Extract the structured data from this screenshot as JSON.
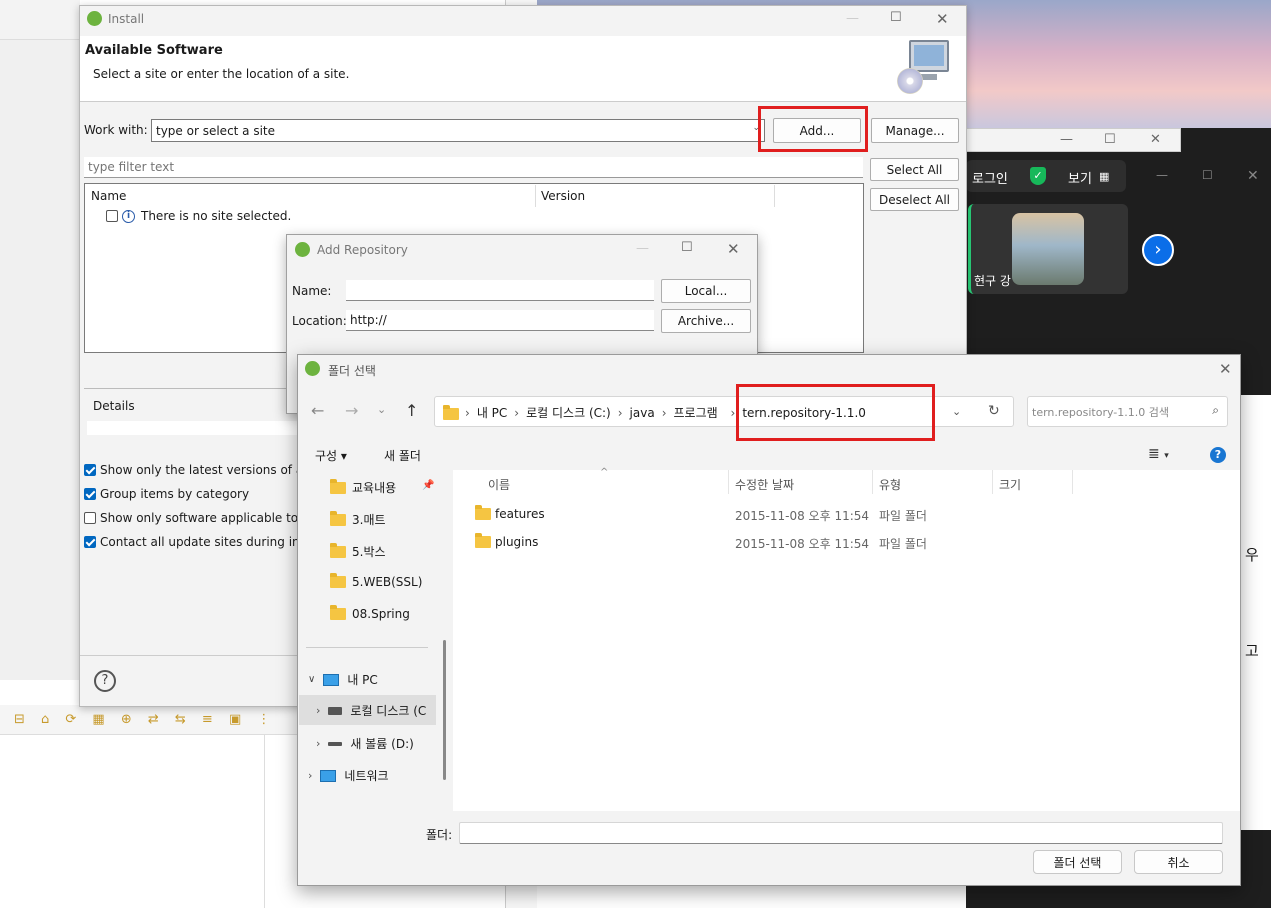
{
  "install": {
    "title": "Install",
    "heading": "Available Software",
    "subheading": "Select a site or enter the location of a site.",
    "work_with_label": "Work with:",
    "work_with_placeholder": "type or select a site",
    "add_button": "Add...",
    "manage_button": "Manage...",
    "filter_placeholder": "type filter text",
    "select_all": "Select All",
    "deselect_all": "Deselect All",
    "col_name": "Name",
    "col_version": "Version",
    "empty_row": "There is no site selected.",
    "details_label": "Details",
    "options": [
      {
        "label": "Show only the latest versions of avai",
        "checked": true
      },
      {
        "label": "Group items by category",
        "checked": true
      },
      {
        "label": "Show only software applicable to tar",
        "checked": false
      },
      {
        "label": "Contact all update sites during instal",
        "checked": true
      }
    ]
  },
  "add_repository": {
    "title": "Add Repository",
    "name_label": "Name:",
    "name_value": "",
    "location_label": "Location:",
    "location_value": "http://",
    "local_button": "Local...",
    "archive_button": "Archive..."
  },
  "folder_dialog": {
    "title": "폴더 선택",
    "breadcrumb": [
      "내 PC",
      "로컬 디스크 (C:)",
      "java",
      "프로그램",
      "tern.repository-1.1.0"
    ],
    "search_placeholder": "tern.repository-1.1.0 검색",
    "organize": "구성 ▾",
    "new_folder": "새 폴더",
    "columns": [
      "이름",
      "수정한 날짜",
      "유형",
      "크기"
    ],
    "files": [
      {
        "name": "features",
        "date": "2015-11-08 오후 11:54",
        "type": "파일 폴더",
        "size": ""
      },
      {
        "name": "plugins",
        "date": "2015-11-08 오후 11:54",
        "type": "파일 폴더",
        "size": ""
      }
    ],
    "quick_access": [
      "교육내용",
      "3.매트",
      "5.박스",
      "5.WEB(SSL)",
      "08.Spring"
    ],
    "this_pc": "내 PC",
    "drive_c": "로컬 디스크 (C",
    "drive_d": "새 볼륨 (D:)",
    "network": "네트워크",
    "folder_label": "폴더:",
    "folder_value": "",
    "select_button": "폴더 선택",
    "cancel_button": "취소"
  },
  "background": {
    "login": "로그인",
    "view": "보기",
    "participant": "현구 강",
    "side_char_1": "우",
    "side_char_2": "고"
  },
  "colors": {
    "accent": "#0067c0",
    "highlight": "#e01e1e"
  }
}
